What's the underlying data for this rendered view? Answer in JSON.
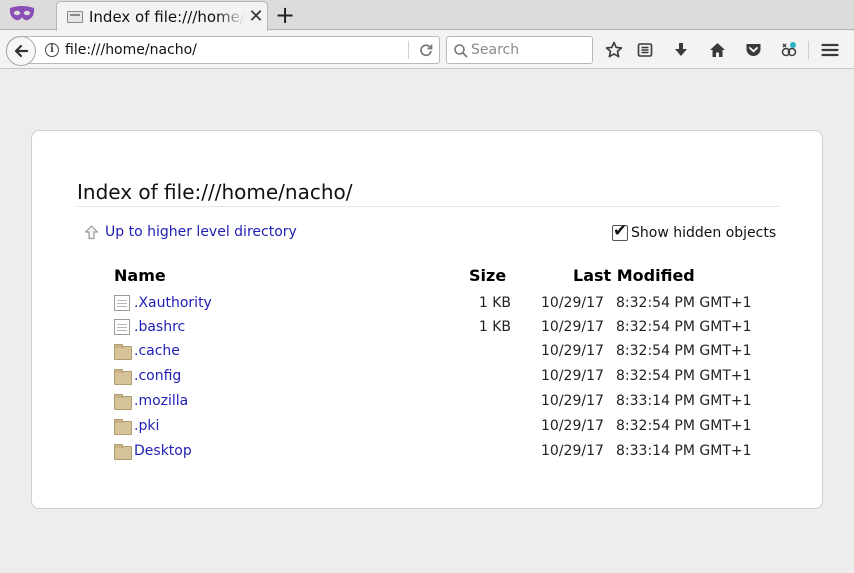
{
  "browser": {
    "tab": {
      "title": "Index of file:///home/nacho/"
    },
    "url": "file:///home/nacho/",
    "search_placeholder": "Search"
  },
  "page": {
    "title": "Index of file:///home/nacho/",
    "up_link": "Up to higher level directory",
    "show_hidden_label": "Show hidden objects",
    "show_hidden_checked": true,
    "columns": {
      "name": "Name",
      "size": "Size",
      "modified": "Last Modified"
    },
    "rows": [
      {
        "type": "file",
        "name": ".Xauthority",
        "size": "1 KB",
        "date": "10/29/17",
        "time": "8:32:54 PM GMT+1"
      },
      {
        "type": "file",
        "name": ".bashrc",
        "size": "1 KB",
        "date": "10/29/17",
        "time": "8:32:54 PM GMT+1"
      },
      {
        "type": "folder",
        "name": ".cache",
        "size": "",
        "date": "10/29/17",
        "time": "8:32:54 PM GMT+1"
      },
      {
        "type": "folder",
        "name": ".config",
        "size": "",
        "date": "10/29/17",
        "time": "8:32:54 PM GMT+1"
      },
      {
        "type": "folder",
        "name": ".mozilla",
        "size": "",
        "date": "10/29/17",
        "time": "8:33:14 PM GMT+1"
      },
      {
        "type": "folder",
        "name": ".pki",
        "size": "",
        "date": "10/29/17",
        "time": "8:32:54 PM GMT+1"
      },
      {
        "type": "folder",
        "name": "Desktop",
        "size": "",
        "date": "10/29/17",
        "time": "8:33:14 PM GMT+1"
      }
    ]
  },
  "colors": {
    "link": "#1f1fb5",
    "app_icon": "#8a4fb5"
  }
}
